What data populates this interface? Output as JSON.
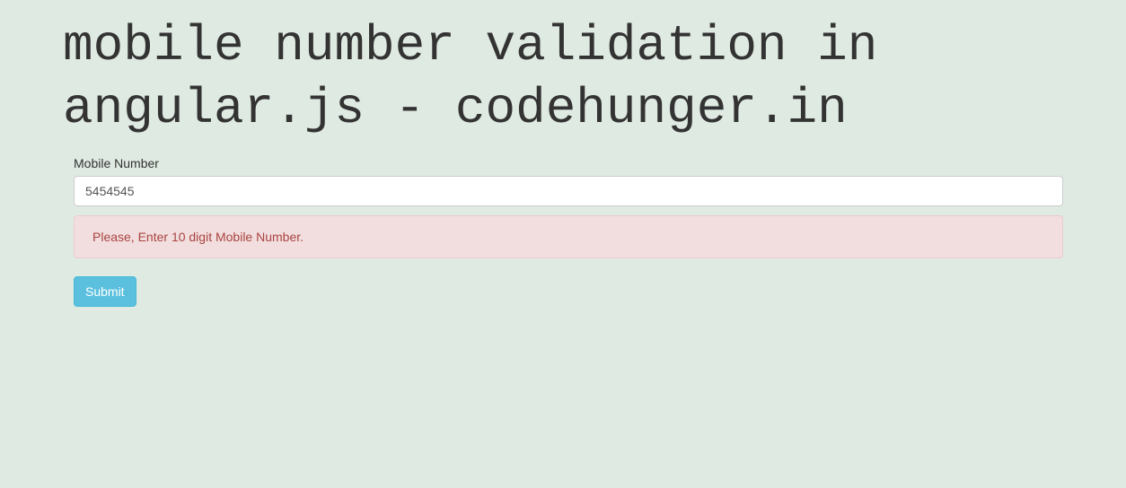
{
  "header": {
    "title": "mobile number validation in angular.js - codehunger.in"
  },
  "form": {
    "mobile_label": "Mobile Number",
    "mobile_value": "5454545",
    "error_message": "Please, Enter 10 digit Mobile Number.",
    "submit_label": "Submit"
  }
}
